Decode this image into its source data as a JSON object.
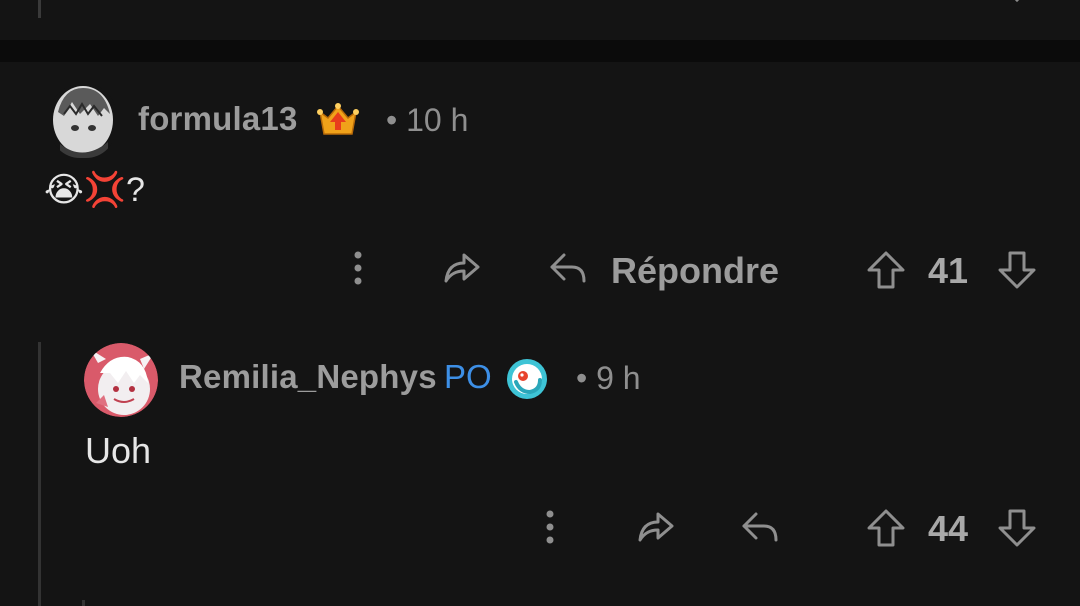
{
  "comments": [
    {
      "username": "formula13",
      "badge_icon": "upvote-award-icon",
      "time": "• 10 h",
      "body": "😭💢?",
      "reply_label": "Répondre",
      "score": "41"
    },
    {
      "username": "Remilia_Nephys",
      "op_tag": "PO",
      "badge_icon": "bubble-award-icon",
      "time": "• 9 h",
      "body": "Uoh",
      "score": "44"
    }
  ],
  "colors": {
    "background": "#141414",
    "username": "#9c9c9c",
    "op_tag": "#3d8fe6",
    "meta": "#8f8f8f",
    "body": "#e6e6e6"
  }
}
